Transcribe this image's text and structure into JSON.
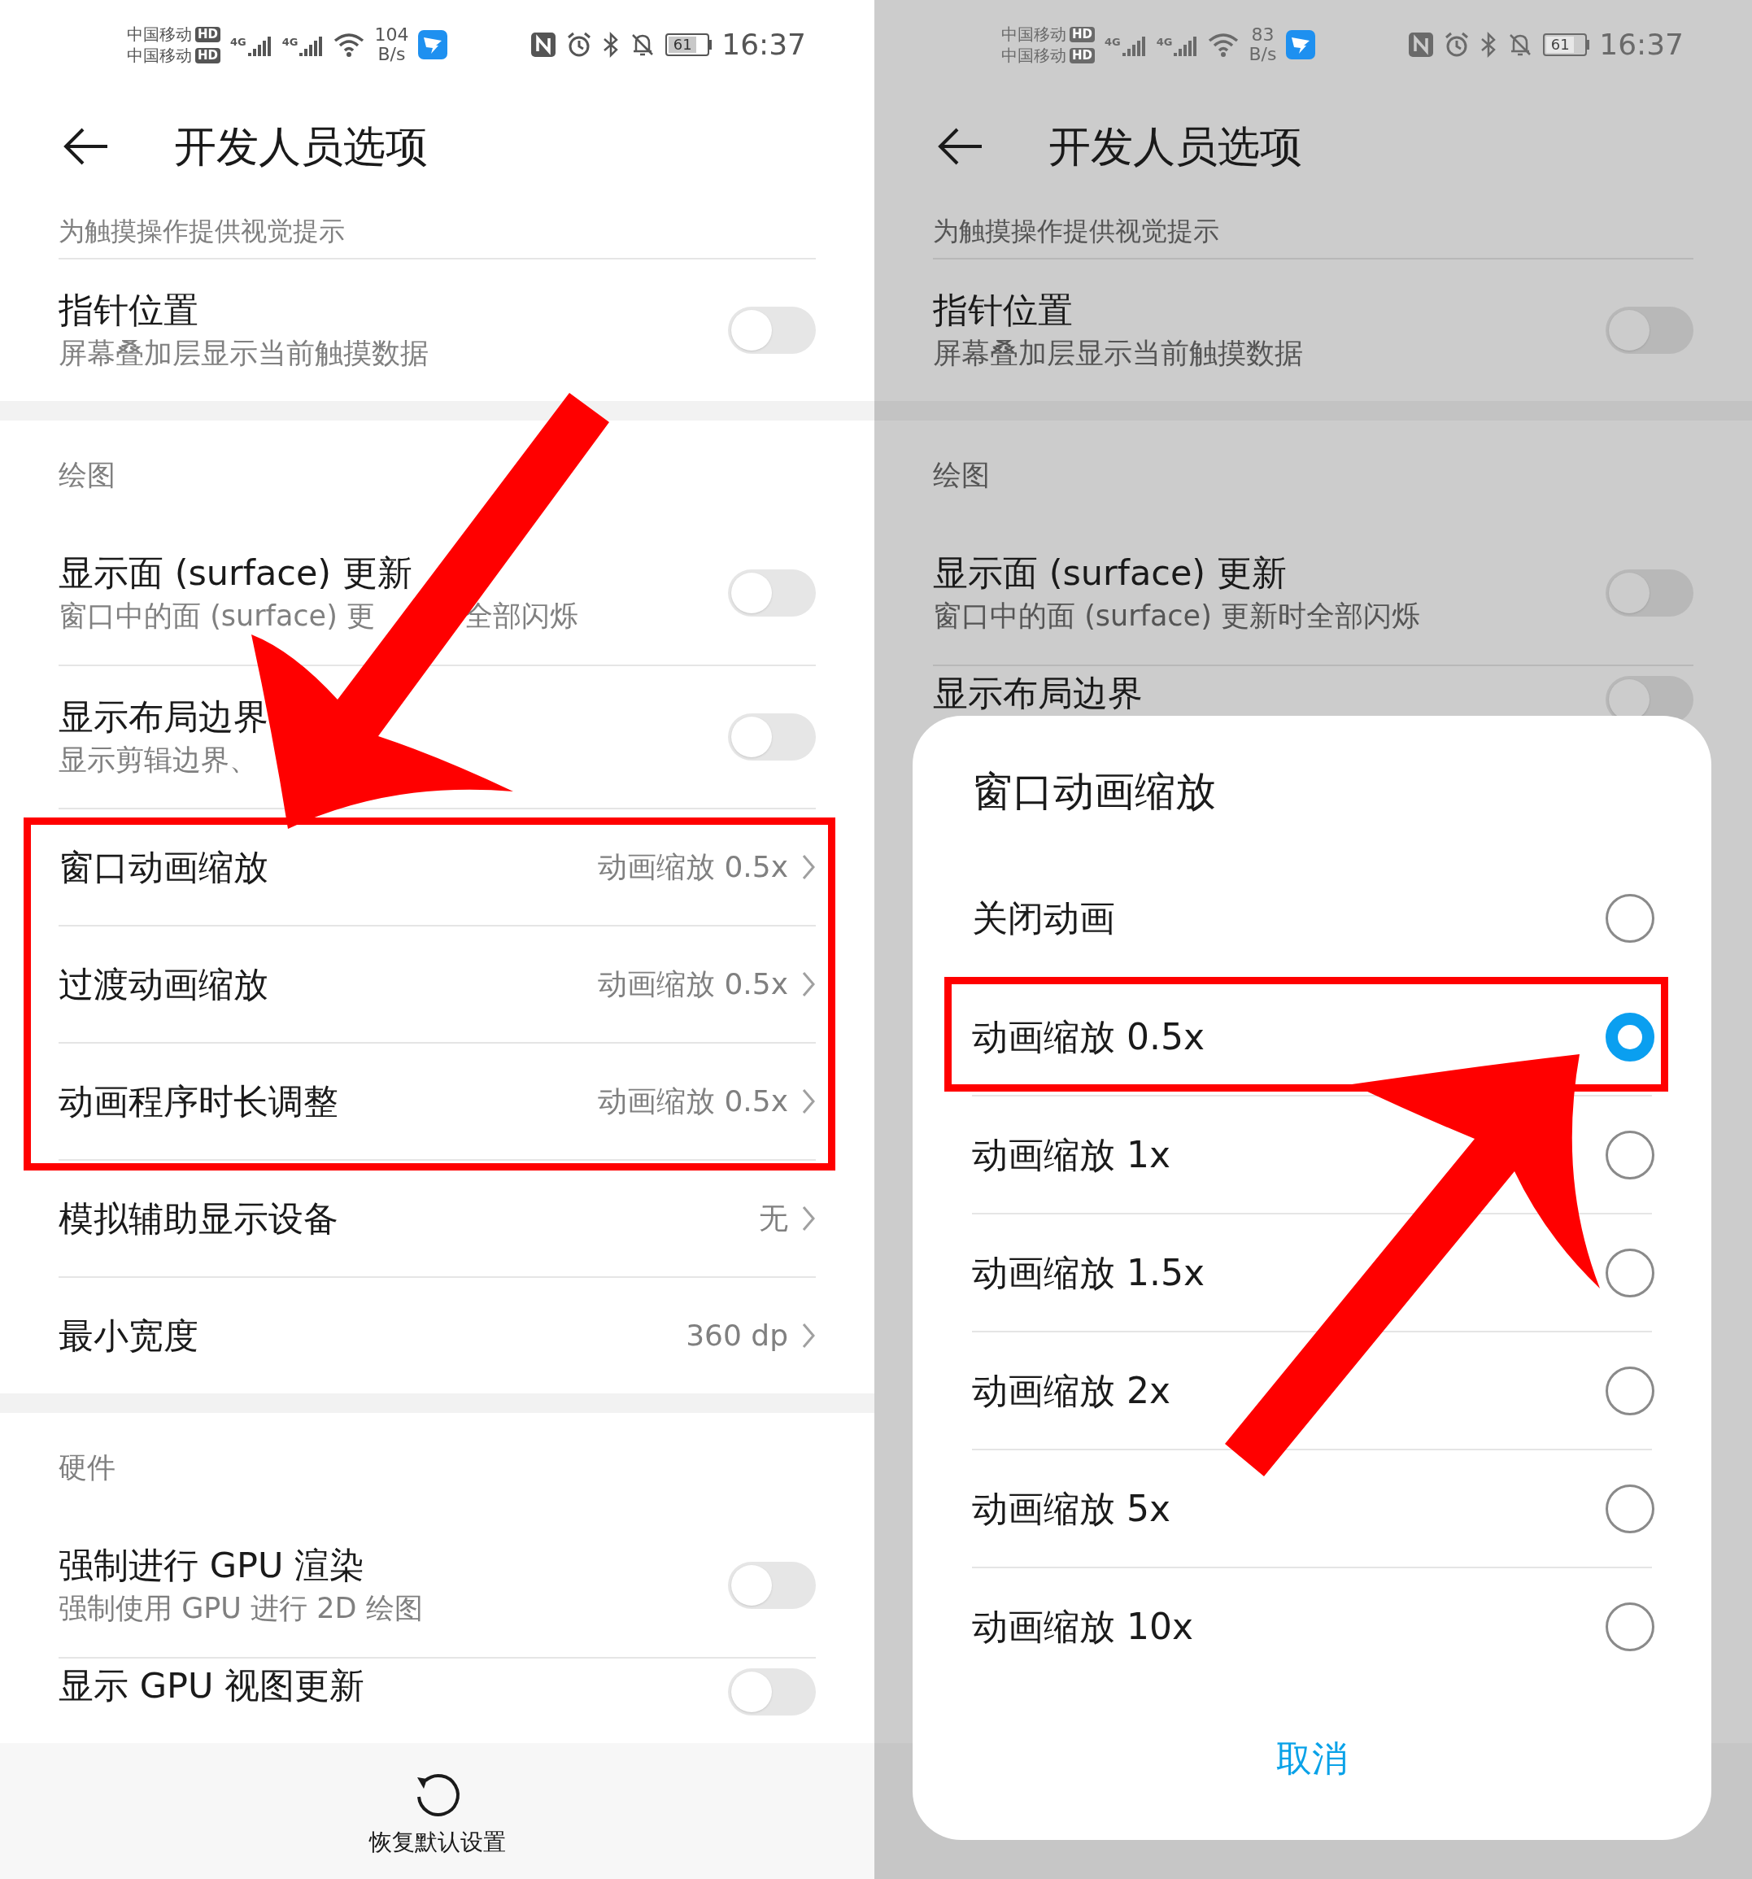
{
  "left_screen": {
    "status_bar": {
      "carriers": [
        {
          "name": "中国移动",
          "badge": "HD"
        },
        {
          "name": "中国移动",
          "badge": "HD"
        }
      ],
      "networks": [
        "4G",
        "4G"
      ],
      "speed_value": "104",
      "speed_unit": "B/s",
      "battery": "61",
      "time": "16:37"
    },
    "header": {
      "title": "开发人员选项"
    },
    "items": [
      {
        "kind": "hint",
        "text": "为触摸操作提供视觉提示"
      },
      {
        "kind": "toggle",
        "title": "指针位置",
        "subtitle": "屏幕叠加层显示当前触摸数据",
        "on": false
      },
      {
        "kind": "gap"
      },
      {
        "kind": "section",
        "title": "绘图"
      },
      {
        "kind": "toggle",
        "title": "显示面 (surface) 更新",
        "subtitle": "窗口中的面 (surface) 更",
        "subtitle_after": "全部闪烁",
        "on": false
      },
      {
        "kind": "toggle",
        "title": "显示布局边界",
        "subtitle": "显示剪辑边界、",
        "on": false
      },
      {
        "kind": "value",
        "title": "窗口动画缩放",
        "value": "动画缩放 0.5x",
        "highlighted": true
      },
      {
        "kind": "value",
        "title": "过渡动画缩放",
        "value": "动画缩放 0.5x",
        "highlighted": true
      },
      {
        "kind": "value",
        "title": "动画程序时长调整",
        "value": "动画缩放 0.5x",
        "highlighted": true
      },
      {
        "kind": "value",
        "title": "模拟辅助显示设备",
        "value": "无"
      },
      {
        "kind": "value",
        "title": "最小宽度",
        "value": "360 dp"
      },
      {
        "kind": "gap"
      },
      {
        "kind": "section",
        "title": "硬件"
      },
      {
        "kind": "toggle",
        "title": "强制进行 GPU 渲染",
        "subtitle": "强制使用 GPU 进行 2D 绘图",
        "on": false
      },
      {
        "kind": "toggle",
        "title": "显示 GPU 视图更新",
        "on": false
      }
    ],
    "footer": {
      "reset_label": "恢复默认设置"
    }
  },
  "right_screen": {
    "status_bar": {
      "carriers": [
        {
          "name": "中国移动",
          "badge": "HD"
        },
        {
          "name": "中国移动",
          "badge": "HD"
        }
      ],
      "networks": [
        "4G",
        "4G"
      ],
      "speed_value": "83",
      "speed_unit": "B/s",
      "battery": "61",
      "time": "16:37"
    },
    "header": {
      "title": "开发人员选项"
    },
    "items": [
      {
        "kind": "hint",
        "text": "为触摸操作提供视觉提示"
      },
      {
        "kind": "toggle",
        "title": "指针位置",
        "subtitle": "屏幕叠加层显示当前触摸数据",
        "on": false
      },
      {
        "kind": "gap"
      },
      {
        "kind": "section",
        "title": "绘图"
      },
      {
        "kind": "toggle",
        "title": "显示面 (surface) 更新",
        "subtitle": "窗口中的面 (surface) 更新时全部闪烁",
        "on": false
      },
      {
        "kind": "toggle",
        "title": "显示布局边界",
        "on": false
      }
    ],
    "dialog": {
      "title": "窗口动画缩放",
      "options": [
        {
          "label": "关闭动画",
          "selected": false
        },
        {
          "label": "动画缩放 0.5x",
          "selected": true,
          "highlighted": true
        },
        {
          "label": "动画缩放 1x",
          "selected": false
        },
        {
          "label": "动画缩放 1.5x",
          "selected": false
        },
        {
          "label": "动画缩放 2x",
          "selected": false
        },
        {
          "label": "动画缩放 5x",
          "selected": false
        },
        {
          "label": "动画缩放 10x",
          "selected": false
        }
      ],
      "cancel": "取消"
    }
  }
}
